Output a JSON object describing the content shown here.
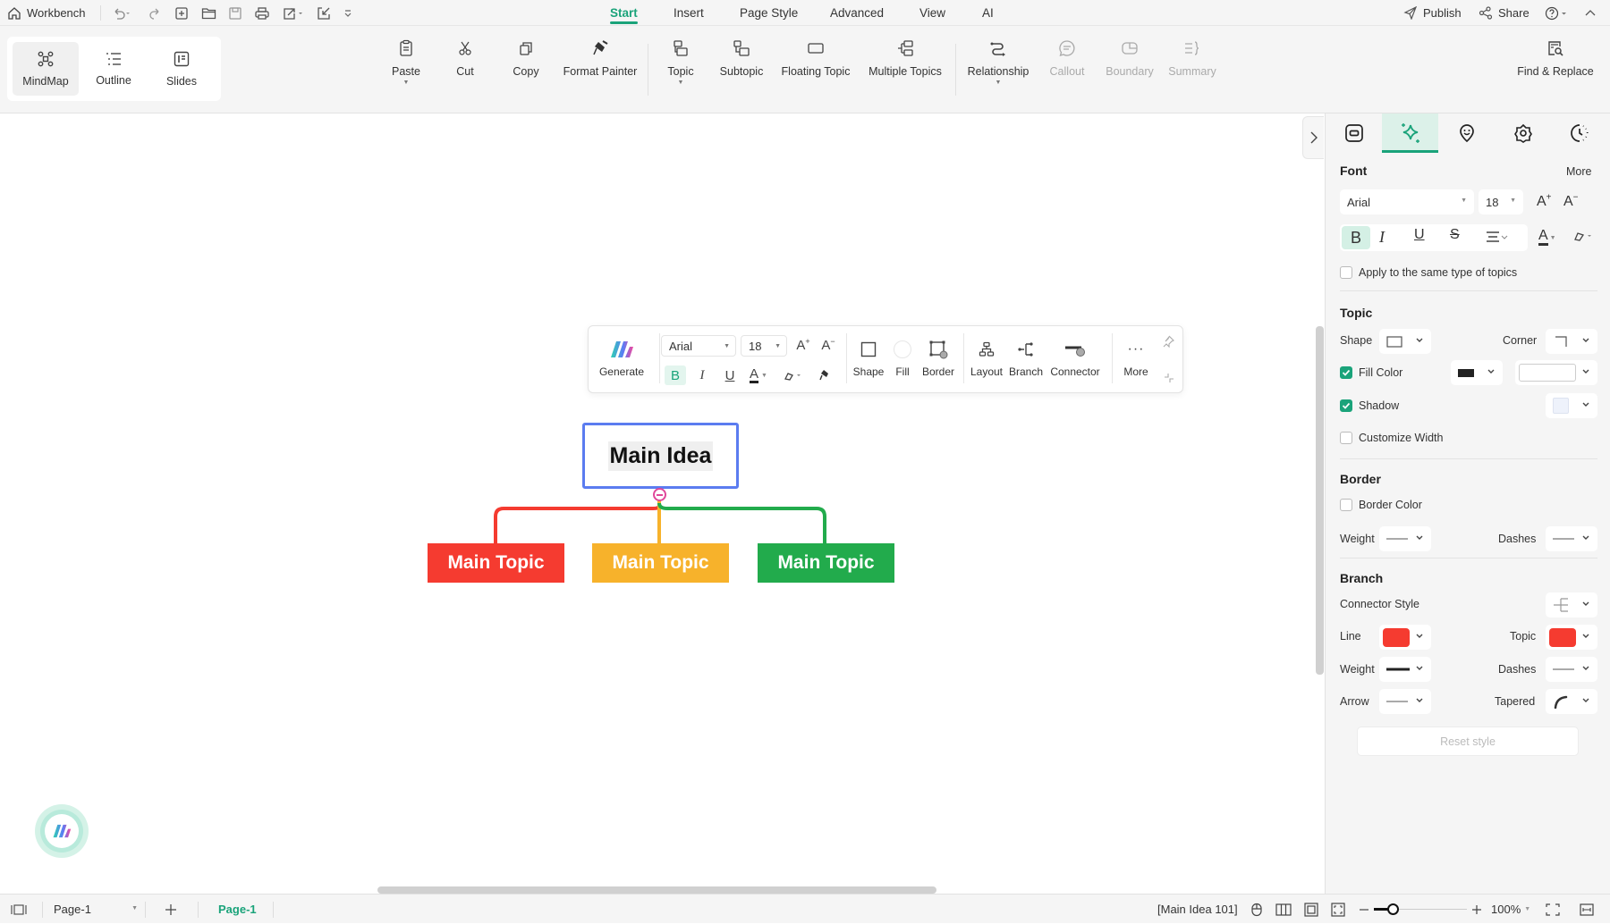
{
  "titlebar": {
    "workbench_label": "Workbench",
    "menu_tabs": [
      "Start",
      "Insert",
      "Page Style",
      "Advanced",
      "View",
      "AI"
    ],
    "active_tab": "Start",
    "publish_label": "Publish",
    "share_label": "Share"
  },
  "view_switch": [
    {
      "label": "MindMap",
      "icon": "mindmap-icon",
      "active": true
    },
    {
      "label": "Outline",
      "icon": "outline-icon",
      "active": false
    },
    {
      "label": "Slides",
      "icon": "slides-icon",
      "active": false
    }
  ],
  "ribbon": {
    "paste": "Paste",
    "cut": "Cut",
    "copy": "Copy",
    "format_painter": "Format Painter",
    "topic": "Topic",
    "subtopic": "Subtopic",
    "floating_topic": "Floating Topic",
    "multiple_topics": "Multiple Topics",
    "relationship": "Relationship",
    "callout": "Callout",
    "boundary": "Boundary",
    "summary": "Summary",
    "find_replace": "Find & Replace"
  },
  "floating_toolbar": {
    "generate": "Generate",
    "font": "Arial",
    "size": "18",
    "shape": "Shape",
    "fill": "Fill",
    "border": "Border",
    "layout": "Layout",
    "branch": "Branch",
    "connector": "Connector",
    "more": "More"
  },
  "mindmap": {
    "main_idea": "Main Idea",
    "topics": [
      {
        "label": "Main Topic",
        "color": "#f53b30"
      },
      {
        "label": "Main Topic",
        "color": "#f7b22b"
      },
      {
        "label": "Main Topic",
        "color": "#22ab4c"
      }
    ],
    "selection_color": "#5b7cf0",
    "collapse_color": "#e0489a"
  },
  "panel": {
    "font": {
      "heading": "Font",
      "more": "More",
      "family": "Arial",
      "size": "18",
      "apply_same": "Apply to the same type of topics",
      "apply_same_checked": false
    },
    "topic": {
      "heading": "Topic",
      "shape_label": "Shape",
      "corner_label": "Corner",
      "fill_color_label": "Fill Color",
      "fill_color_checked": true,
      "fill_swatch": "#222222",
      "shadow_label": "Shadow",
      "shadow_checked": true,
      "customize_width_label": "Customize Width",
      "customize_width_checked": false
    },
    "border": {
      "heading": "Border",
      "border_color_label": "Border Color",
      "border_color_checked": false,
      "weight_label": "Weight",
      "dashes_label": "Dashes"
    },
    "branch": {
      "heading": "Branch",
      "connector_style_label": "Connector Style",
      "line_label": "Line",
      "line_color": "#f53b30",
      "topic_label": "Topic",
      "topic_color": "#f53b30",
      "weight_label": "Weight",
      "dashes_label": "Dashes",
      "arrow_label": "Arrow",
      "tapered_label": "Tapered"
    },
    "reset_label": "Reset style"
  },
  "statusbar": {
    "page_select": "Page-1",
    "page_tab": "Page-1",
    "selection_info": "[Main Idea 101]",
    "zoom": "100%",
    "zoom_fraction": 0.2
  },
  "accent": "#1aa37a"
}
